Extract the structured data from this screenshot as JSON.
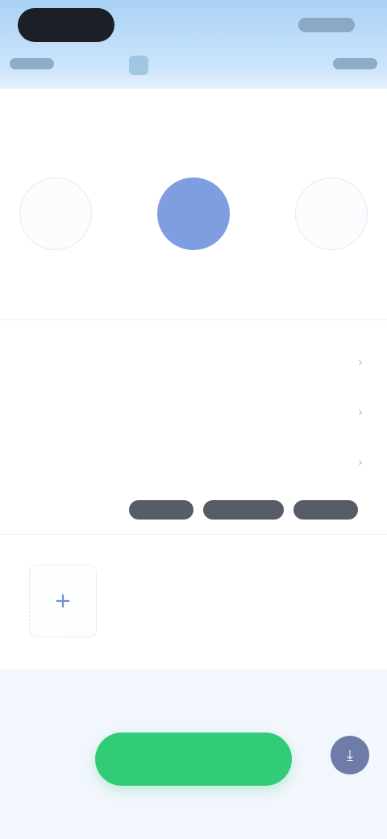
{
  "header": {
    "title": "",
    "left_action": "",
    "right_action": ""
  },
  "form": {
    "section_title": "",
    "choices": [
      {
        "label": ""
      },
      {
        "label": ""
      },
      {
        "label": ""
      }
    ],
    "helper_label": "",
    "rows": [
      {
        "label": "",
        "chevron": "›"
      },
      {
        "label": "",
        "chevron": "›"
      },
      {
        "label": "",
        "chevron": "›"
      }
    ],
    "row4_label": "",
    "segments": [
      "",
      "",
      ""
    ]
  },
  "add": {
    "icon": "+"
  },
  "footer": {
    "primary_label": "",
    "fab_icon": "⤓"
  },
  "colors": {
    "accent_green": "#32cc76",
    "selected_blue": "#7f9ee2",
    "topbar_blue": "#a9d2f6"
  }
}
